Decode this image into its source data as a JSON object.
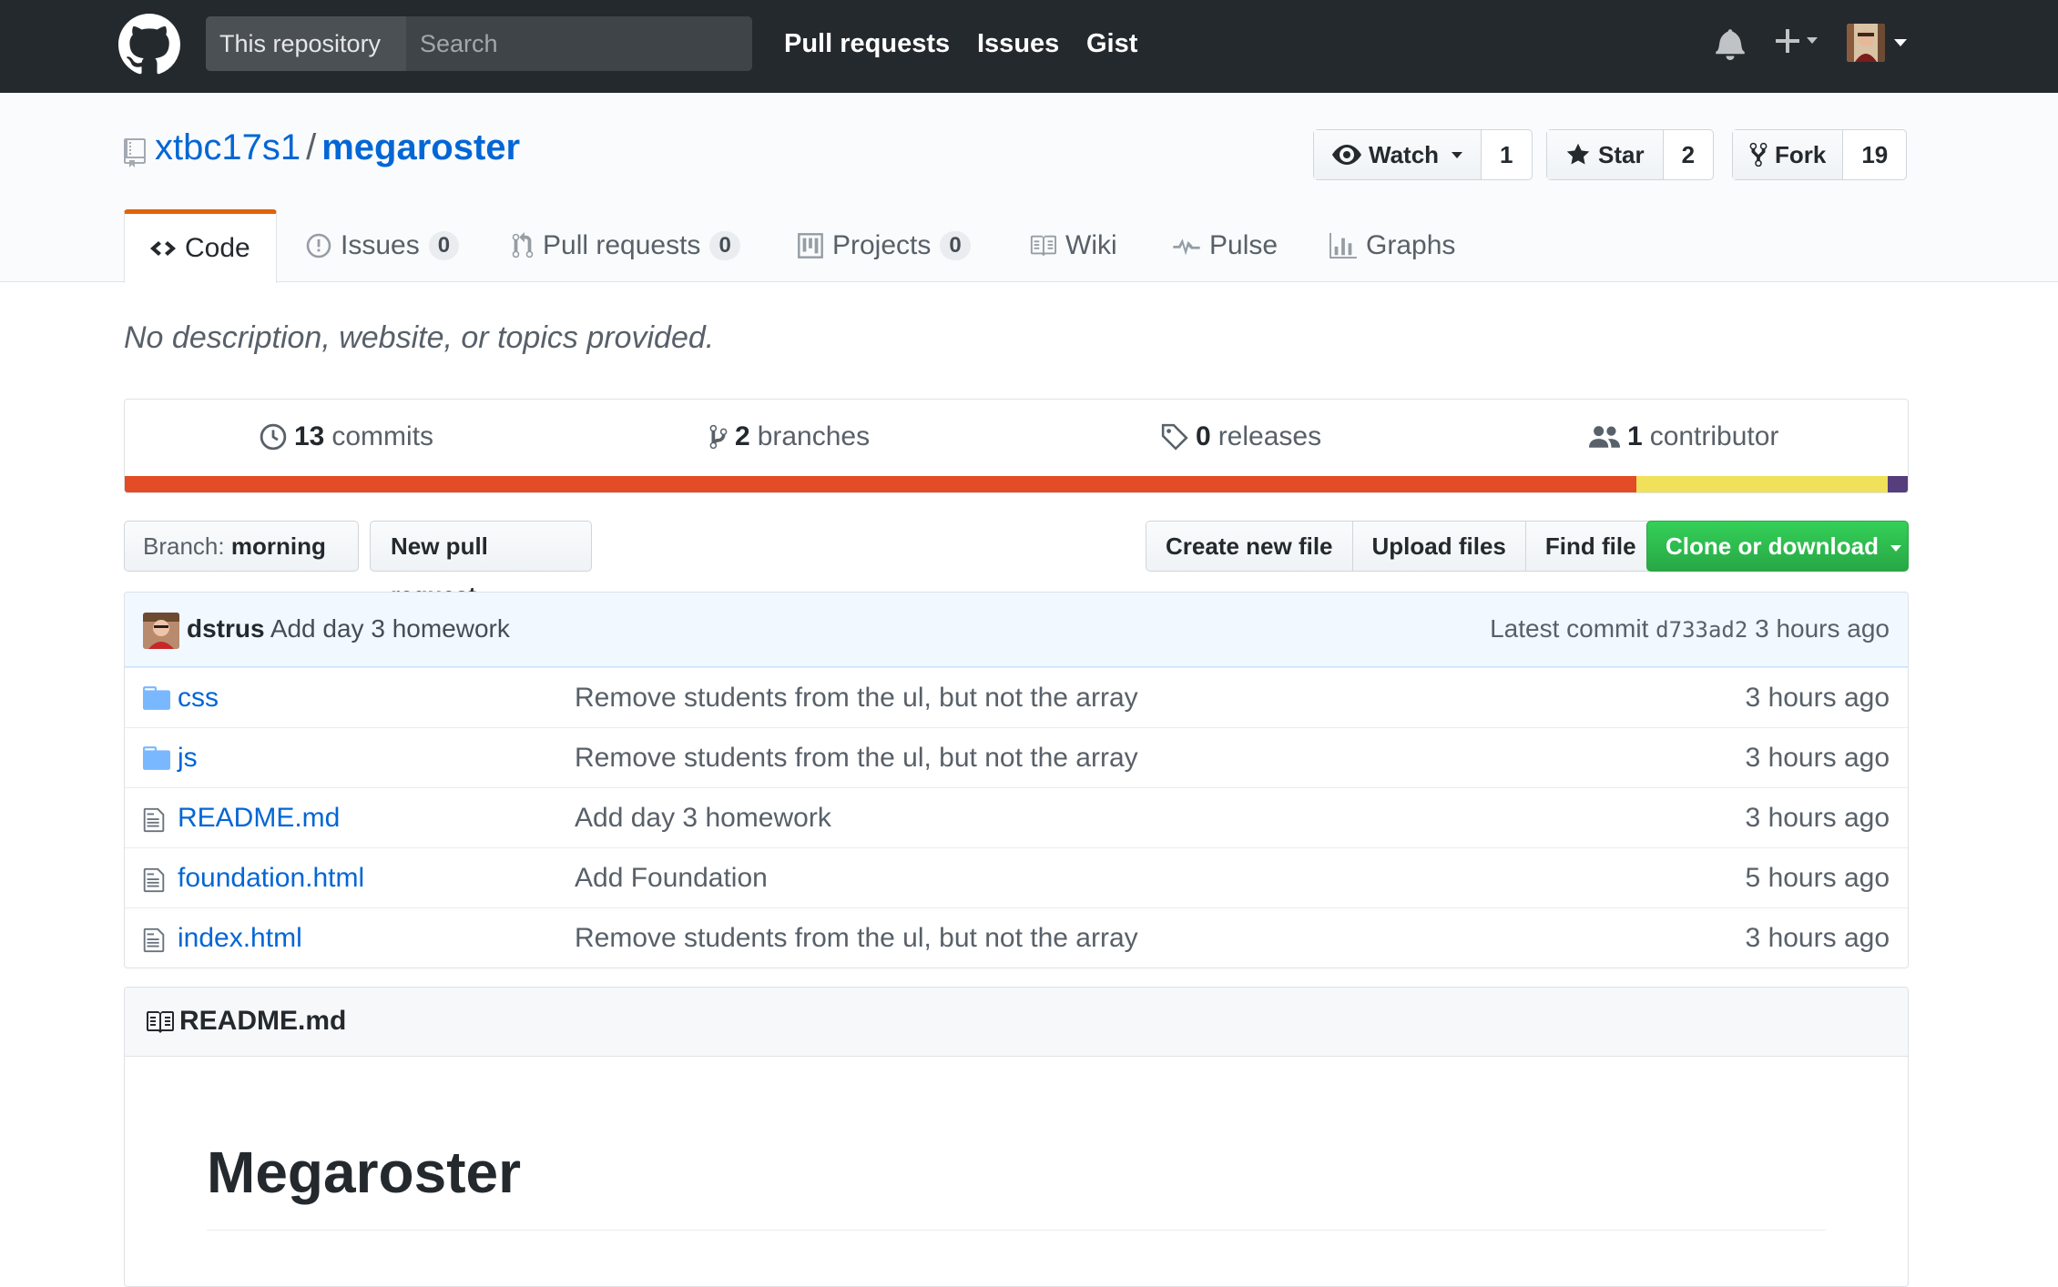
{
  "header": {
    "search_scope": "This repository",
    "search_placeholder": "Search",
    "nav": [
      "Pull requests",
      "Issues",
      "Gist"
    ]
  },
  "repo": {
    "owner": "xtbc17s1",
    "separator": "/",
    "name": "megaroster",
    "watch_label": "Watch",
    "watch_count": "1",
    "star_label": "Star",
    "star_count": "2",
    "fork_label": "Fork",
    "fork_count": "19"
  },
  "tabs": [
    {
      "label": "Code"
    },
    {
      "label": "Issues",
      "count": "0"
    },
    {
      "label": "Pull requests",
      "count": "0"
    },
    {
      "label": "Projects",
      "count": "0"
    },
    {
      "label": "Wiki"
    },
    {
      "label": "Pulse"
    },
    {
      "label": "Graphs"
    }
  ],
  "description": "No description, website, or topics provided.",
  "summary": {
    "commits_count": "13",
    "commits_label": "commits",
    "branches_count": "2",
    "branches_label": "branches",
    "releases_count": "0",
    "releases_label": "releases",
    "contributors_count": "1",
    "contributors_label": "contributor",
    "languages": [
      {
        "color": "#e34c26",
        "fraction": 0.847
      },
      {
        "color": "#f1e05a",
        "fraction": 0.141
      },
      {
        "color": "#563d7c",
        "fraction": 0.012
      }
    ]
  },
  "toolbar": {
    "branch_label": "Branch:",
    "branch_name": "morning",
    "new_pr": "New pull request",
    "create_file": "Create new file",
    "upload_files": "Upload files",
    "find_file": "Find file",
    "clone": "Clone or download"
  },
  "commit": {
    "author": "dstrus",
    "message": "Add day 3 homework",
    "latest_label": "Latest commit",
    "sha": "d733ad2",
    "age": "3 hours ago"
  },
  "files": [
    {
      "type": "dir",
      "name": "css",
      "message": "Remove students from the ul, but not the array",
      "age": "3 hours ago"
    },
    {
      "type": "dir",
      "name": "js",
      "message": "Remove students from the ul, but not the array",
      "age": "3 hours ago"
    },
    {
      "type": "file",
      "name": "README.md",
      "message": "Add day 3 homework",
      "age": "3 hours ago"
    },
    {
      "type": "file",
      "name": "foundation.html",
      "message": "Add Foundation",
      "age": "5 hours ago"
    },
    {
      "type": "file",
      "name": "index.html",
      "message": "Remove students from the ul, but not the array",
      "age": "3 hours ago"
    }
  ],
  "readme": {
    "title": "README.md",
    "heading": "Megaroster"
  }
}
